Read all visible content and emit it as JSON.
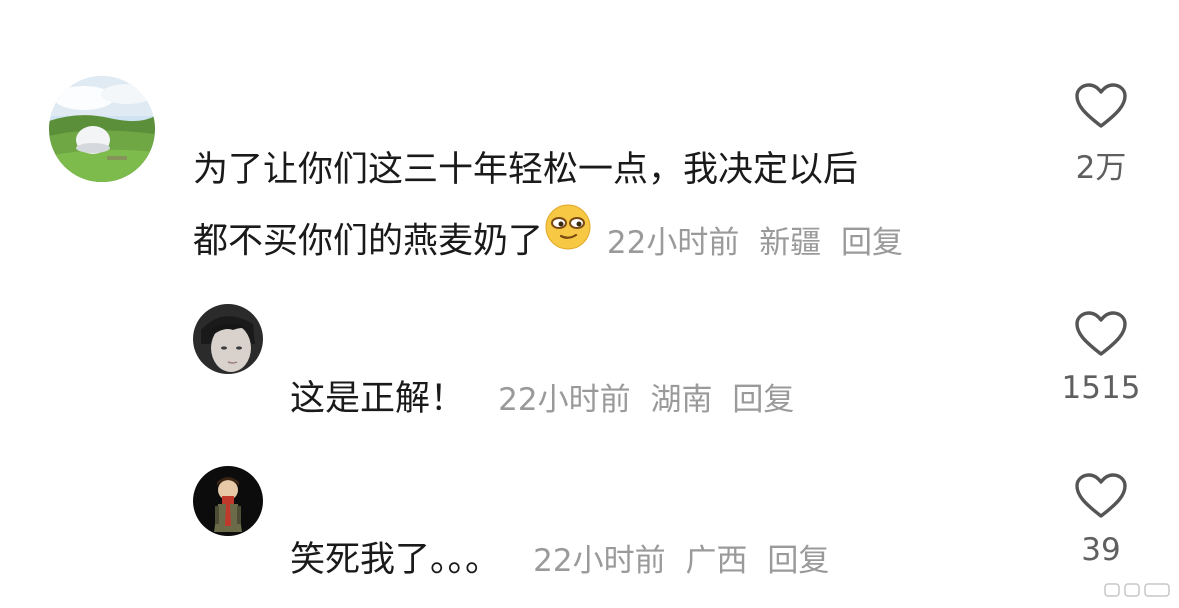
{
  "comments": [
    {
      "text_line1": "为了让你们这三十年轻松一点，我决定以后",
      "text_line2": "都不买你们的燕麦奶了",
      "emoji": "smug-face-emoji",
      "time": "22小时前",
      "location": "新疆",
      "reply_label": "回复",
      "likes": "2万"
    },
    {
      "text": "这是正解！",
      "time": "22小时前",
      "location": "湖南",
      "reply_label": "回复",
      "likes": "1515"
    },
    {
      "text": "笑死我了。。。",
      "time": "22小时前",
      "location": "广西",
      "reply_label": "回复",
      "likes": "39"
    }
  ],
  "icons": {
    "like": "heart-outline-icon"
  },
  "colors": {
    "text": "#1a1a1a",
    "meta": "#9a9a9a",
    "like_count": "#5f5f5f",
    "heart": "#555555"
  }
}
